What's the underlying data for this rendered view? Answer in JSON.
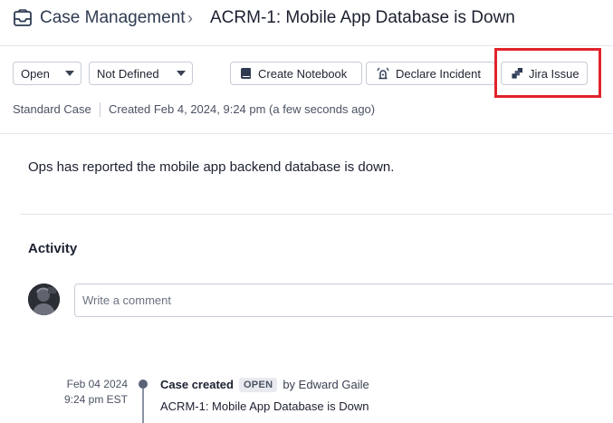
{
  "header": {
    "breadcrumb_root": "Case Management",
    "breadcrumb_separator": "›",
    "title": "ACRM-1:  Mobile App Database is Down"
  },
  "toolbar": {
    "status_select": "Open",
    "priority_select": "Not Defined",
    "create_notebook_label": "Create Notebook",
    "declare_incident_label": "Declare Incident",
    "jira_issue_label": "Jira Issue"
  },
  "meta": {
    "case_type": "Standard Case",
    "created": "Created Feb 4, 2024, 9:24 pm (a few seconds ago)"
  },
  "description": "Ops has reported the mobile app backend database is down.",
  "activity": {
    "heading": "Activity",
    "comment_placeholder": "Write a comment",
    "events": [
      {
        "date": "Feb 04 2024",
        "time": "9:24 pm EST",
        "title": "Case created",
        "badge": "OPEN",
        "by": "by Edward Gaile",
        "subtitle": "ACRM-1: Mobile App Database is Down"
      }
    ]
  },
  "icons": {
    "header": "case-inbox-icon",
    "notebook": "notebook-icon",
    "incident": "siren-icon",
    "jira": "jira-icon"
  },
  "colors": {
    "highlight": "#e0232c",
    "border": "#c7ccd6",
    "text": "#1c2030"
  }
}
